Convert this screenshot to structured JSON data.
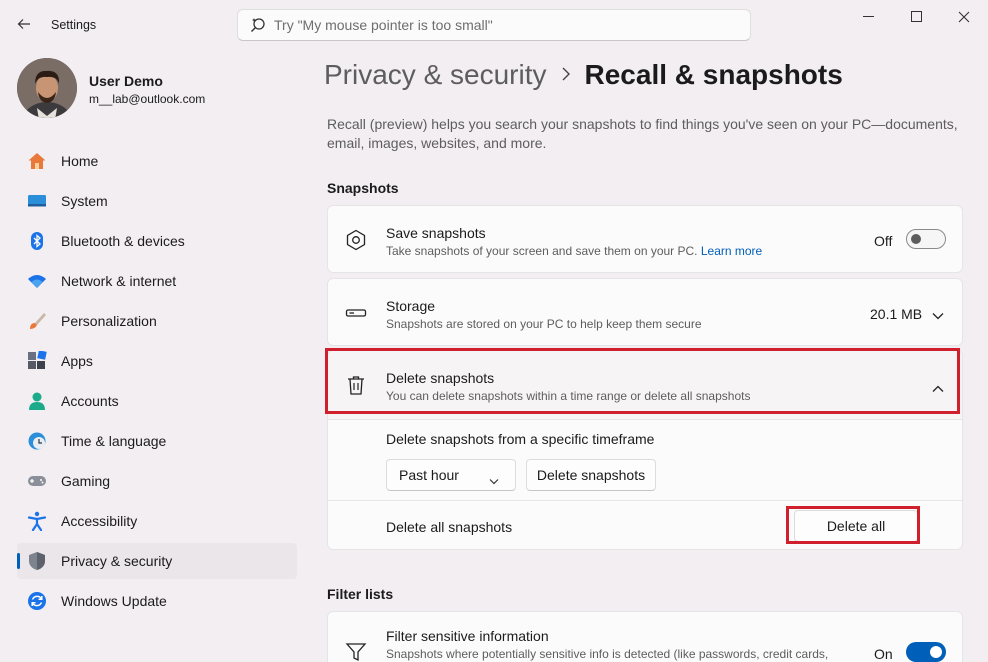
{
  "window": {
    "app_title": "Settings",
    "search_placeholder": "Try \"My mouse pointer is too small\""
  },
  "profile": {
    "name": "User Demo",
    "email": "m__lab@outlook.com"
  },
  "sidebar": {
    "items": [
      {
        "label": "Home",
        "icon": "home-icon"
      },
      {
        "label": "System",
        "icon": "system-icon"
      },
      {
        "label": "Bluetooth & devices",
        "icon": "bluetooth-icon"
      },
      {
        "label": "Network & internet",
        "icon": "wifi-icon"
      },
      {
        "label": "Personalization",
        "icon": "brush-icon"
      },
      {
        "label": "Apps",
        "icon": "apps-icon"
      },
      {
        "label": "Accounts",
        "icon": "accounts-icon"
      },
      {
        "label": "Time & language",
        "icon": "clock-globe-icon"
      },
      {
        "label": "Gaming",
        "icon": "gamepad-icon"
      },
      {
        "label": "Accessibility",
        "icon": "accessibility-icon"
      },
      {
        "label": "Privacy & security",
        "icon": "shield-icon",
        "active": true
      },
      {
        "label": "Windows Update",
        "icon": "update-icon"
      }
    ]
  },
  "main": {
    "breadcrumb_parent": "Privacy & security",
    "breadcrumb_current": "Recall & snapshots",
    "description": "Recall (preview) helps you search your snapshots to find things you've seen on your PC—documents, email, images, websites, and more.",
    "snapshots_section": "Snapshots",
    "save_snapshots": {
      "title": "Save snapshots",
      "subtitle": "Take snapshots of your screen and save them on your PC.",
      "link": "Learn more",
      "state_label": "Off",
      "on": false
    },
    "storage": {
      "title": "Storage",
      "subtitle": "Snapshots are stored on your PC to help keep them secure",
      "value": "20.1 MB"
    },
    "delete_snapshots": {
      "title": "Delete snapshots",
      "subtitle": "You can delete snapshots within a time range or delete all snapshots",
      "timeframe_label": "Delete snapshots from a specific timeframe",
      "timeframe_selected": "Past hour",
      "delete_button": "Delete snapshots",
      "delete_all_label": "Delete all snapshots",
      "delete_all_button": "Delete all"
    },
    "filter_section": "Filter lists",
    "filter_sensitive": {
      "title": "Filter sensitive information",
      "subtitle": "Snapshots where potentially sensitive info is detected (like passwords, credit cards,",
      "state_label": "On",
      "on": true
    }
  },
  "colors": {
    "accent": "#005fb8",
    "highlight": "#d1202d",
    "background": "#f3eef2"
  }
}
